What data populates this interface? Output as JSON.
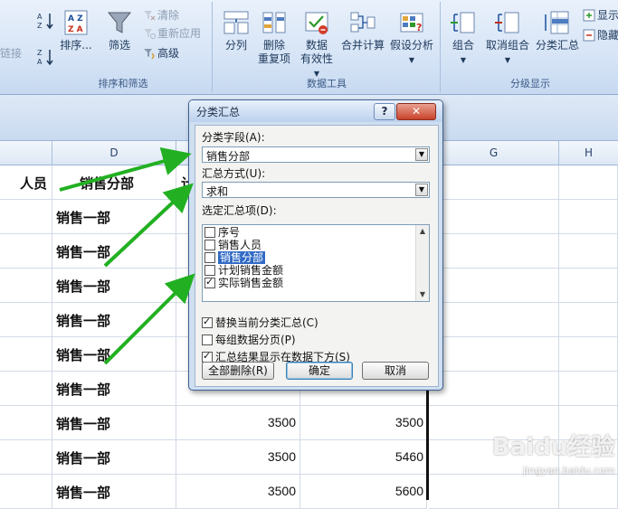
{
  "ribbon": {
    "sort_filter": {
      "group_label": "排序和筛选",
      "sort_label": "排序...",
      "filter_label": "筛选",
      "clear_label": "清除",
      "reapply_label": "重新应用",
      "advanced_label": "高级",
      "left_cut_label": "链接"
    },
    "data_tools": {
      "group_label": "数据工具",
      "split_label": "分列",
      "remove_dup_line1": "删除",
      "remove_dup_line2": "重复项",
      "validation_line1": "数据",
      "validation_line2": "有效性",
      "consolidate_label": "合并计算",
      "whatif_label": "假设分析"
    },
    "outline": {
      "group_label": "分级显示",
      "group_btn": "组合",
      "ungroup_btn": "取消组合",
      "subtotal_btn": "分类汇总",
      "show_label": "显示",
      "hide_label": "隐藏"
    }
  },
  "sheet": {
    "col_headers": {
      "d": "D",
      "g": "G",
      "h": "H"
    },
    "header_cells": {
      "c": "人员",
      "d": "销售分部",
      "e": "计"
    },
    "rows": [
      {
        "d": "销售一部",
        "e": "",
        "f": ""
      },
      {
        "d": "销售一部",
        "e": "",
        "f": ""
      },
      {
        "d": "销售一部",
        "e": "",
        "f": ""
      },
      {
        "d": "销售一部",
        "e": "",
        "f": ""
      },
      {
        "d": "销售一部",
        "e": "",
        "f": ""
      },
      {
        "d": "销售一部",
        "e": "",
        "f": ""
      },
      {
        "d": "销售一部",
        "e": "3500",
        "f": "3500"
      },
      {
        "d": "销售一部",
        "e": "3500",
        "f": "5460"
      },
      {
        "d": "销售一部",
        "e": "3500",
        "f": "5600"
      }
    ]
  },
  "dialog": {
    "title": "分类汇总",
    "help": "?",
    "close": "✕",
    "group_by_label": "分类字段(A):",
    "group_by_value": "销售分部",
    "function_label": "汇总方式(U):",
    "function_value": "求和",
    "add_subtotal_label": "选定汇总项(D):",
    "items": [
      {
        "label": "序号",
        "checked": false
      },
      {
        "label": "销售人员",
        "checked": false
      },
      {
        "label": "销售分部",
        "checked": false
      },
      {
        "label": "计划销售金额",
        "checked": false
      },
      {
        "label": "实际销售金额",
        "checked": true
      }
    ],
    "options": {
      "replace": "替换当前分类汇总(C)",
      "page_break": "每组数据分页(P)",
      "summary_below": "汇总结果显示在数据下方(S)"
    },
    "buttons": {
      "remove_all": "全部删除(R)",
      "ok": "确定",
      "cancel": "取消"
    }
  },
  "watermark": {
    "brand": "Baidu经验",
    "url": "jingyan.baidu.com"
  },
  "colors": {
    "accent": "#316ac5",
    "arrow": "#22b022",
    "close": "#c9432b"
  }
}
